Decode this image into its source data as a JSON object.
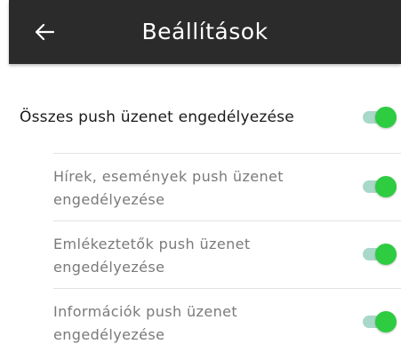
{
  "header": {
    "back_icon": "arrow-left-icon",
    "title": "Beállítások",
    "background_color": "#2b2b2b"
  },
  "settings": {
    "all_push": {
      "label": "Összes push üzenet engedélyezése",
      "enabled": true
    },
    "items": [
      {
        "label_line1": "Hírek, események push üzenet",
        "label_line2": "engedélyezése",
        "enabled": true
      },
      {
        "label_line1": "Emlékeztetők push üzenet",
        "label_line2": "engedélyezése",
        "enabled": true
      },
      {
        "label_line1": "Információk push üzenet",
        "label_line2": "engedélyezése",
        "enabled": true
      }
    ]
  },
  "colors": {
    "toggle_thumb_on": "#2ecc40",
    "toggle_track_on": "#a8d8c8"
  }
}
